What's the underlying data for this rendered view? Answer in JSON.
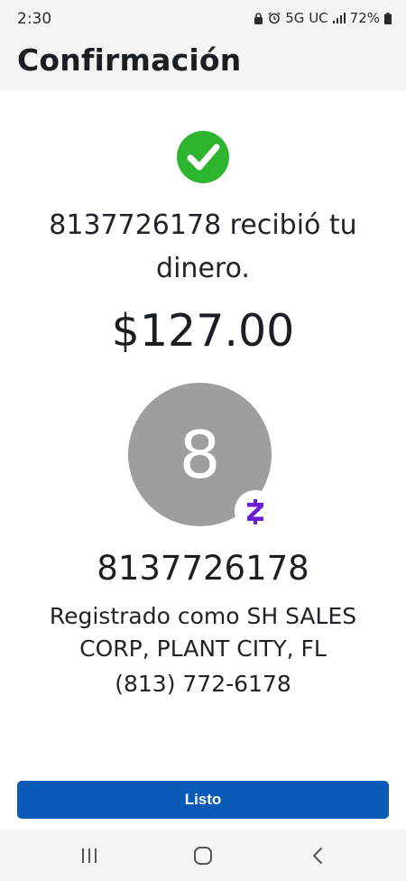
{
  "status_bar": {
    "time": "2:30",
    "network": "5G UC",
    "battery": "72%"
  },
  "header": {
    "title": "Confirmación"
  },
  "confirmation": {
    "message": "8137726178 recibió tu dinero.",
    "amount": "$127.00",
    "avatar_initial": "8",
    "recipient": "8137726178",
    "registered_as": "Registrado como SH SALES CORP, PLANT CITY, FL",
    "phone": "(813) 772-6178"
  },
  "actions": {
    "done_label": "Listo"
  },
  "colors": {
    "success_green": "#2eb52f",
    "primary_blue": "#0a5ab8",
    "zelle_purple": "#6d1ed4",
    "avatar_gray": "#9e9e9e"
  },
  "icons": {
    "success": "check-circle-icon",
    "badge": "zelle-logo-icon",
    "nav_recents": "recents-icon",
    "nav_home": "home-icon",
    "nav_back": "back-icon"
  }
}
